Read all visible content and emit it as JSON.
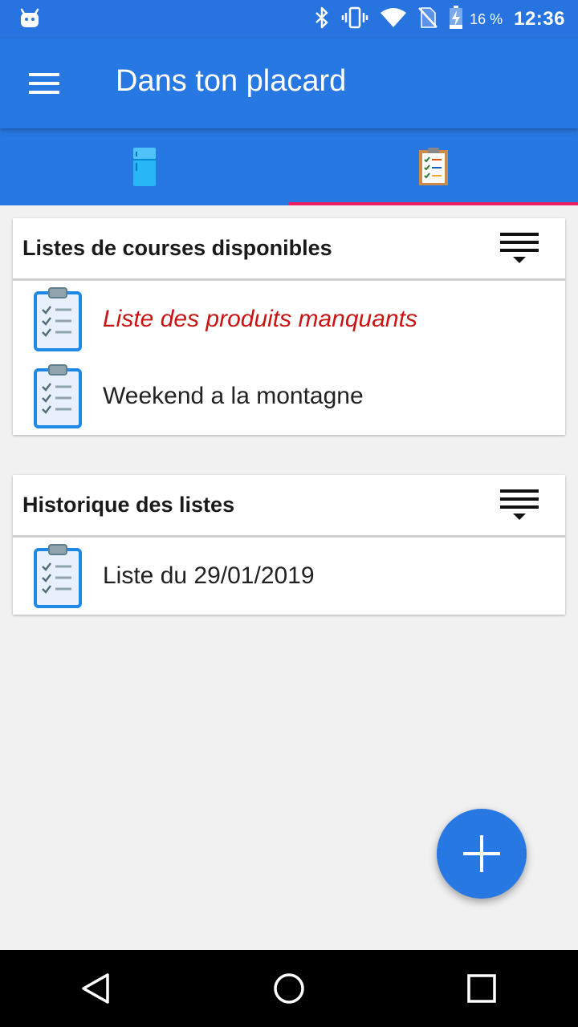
{
  "status_bar": {
    "battery": "16 %",
    "time": "12:36",
    "icons": [
      "android-icon",
      "bluetooth-icon",
      "vibrate-icon",
      "wifi-icon",
      "no-sim-icon",
      "battery-charging-icon"
    ]
  },
  "app_bar": {
    "title": "Dans ton placard",
    "menu_icon": "hamburger-menu-icon"
  },
  "tabs": [
    {
      "icon": "fridge-icon",
      "active": false
    },
    {
      "icon": "checklist-icon",
      "active": true
    }
  ],
  "available_lists": {
    "title": "Listes de courses disponibles",
    "sort_icon": "sort-menu-icon",
    "items": [
      {
        "label": "Liste des produits manquants",
        "highlight": true
      },
      {
        "label": "Weekend a la montagne",
        "highlight": false
      }
    ]
  },
  "history": {
    "title": "Historique des listes",
    "sort_icon": "sort-menu-icon",
    "items": [
      {
        "label": "Liste du 29/01/2019"
      }
    ]
  },
  "fab": {
    "icon": "plus-icon"
  },
  "nav_bar": {
    "icons": [
      "back-triangle-icon",
      "home-circle-icon",
      "recents-square-icon"
    ]
  },
  "colors": {
    "primary": "#2878e3",
    "status_bar": "#2774e0",
    "tab_indicator": "#e91e63",
    "highlight_text": "#c81414"
  }
}
